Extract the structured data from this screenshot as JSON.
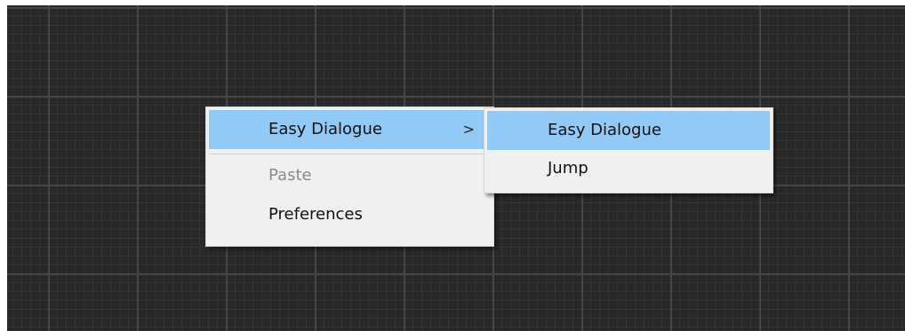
{
  "context_menu": {
    "items": [
      {
        "label": "Easy Dialogue",
        "has_submenu": true,
        "highlighted": true
      },
      {
        "label": "Paste",
        "disabled": true
      },
      {
        "label": "Preferences",
        "disabled": false
      }
    ],
    "submenu_arrow": ">"
  },
  "submenu": {
    "items": [
      {
        "label": "Easy Dialogue",
        "highlighted": true
      },
      {
        "label": "Jump"
      }
    ]
  },
  "colors": {
    "canvas_background": "#282828",
    "menu_background": "#f0f0f0",
    "highlight": "#91c9f7",
    "disabled_text": "#8c8c8c"
  }
}
